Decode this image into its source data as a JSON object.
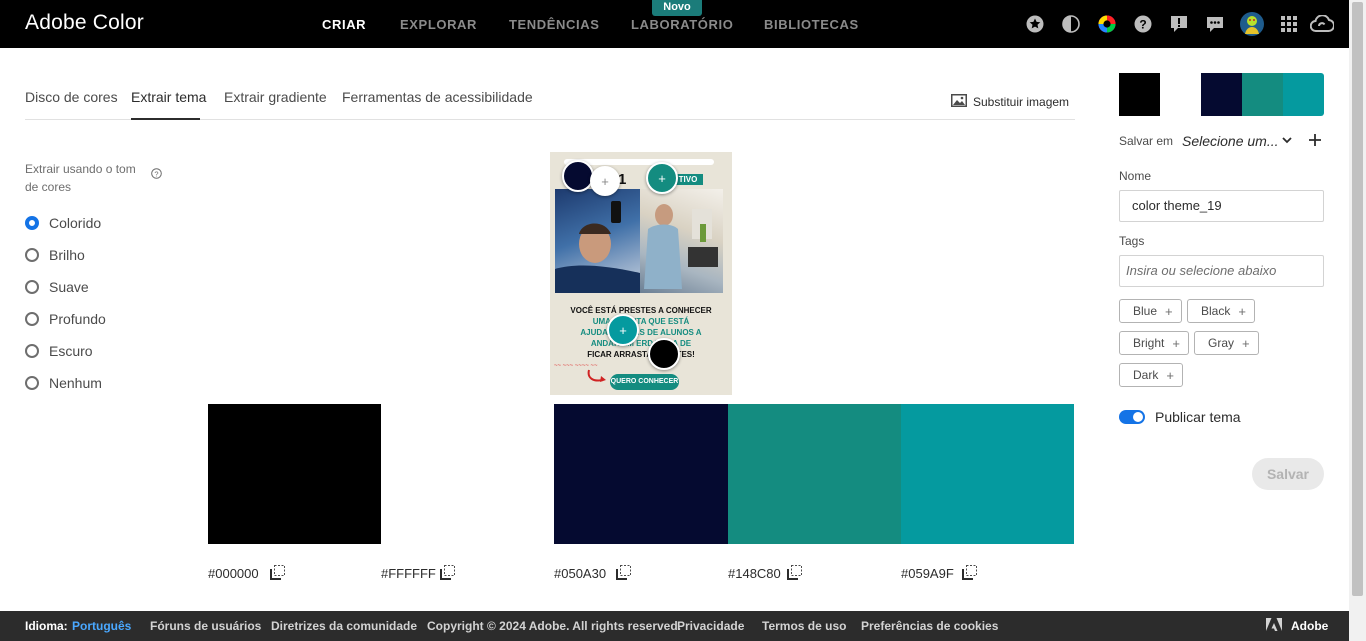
{
  "app_title": "Adobe Color",
  "nav": {
    "items": [
      {
        "label": "CRIAR",
        "active": true
      },
      {
        "label": "EXPLORAR",
        "active": false
      },
      {
        "label": "TENDÊNCIAS",
        "active": false
      },
      {
        "label": "LABORATÓRIO",
        "active": false
      },
      {
        "label": "BIBLIOTECAS",
        "active": false
      }
    ],
    "badge": "Novo"
  },
  "tabs": [
    "Disco de cores",
    "Extrair tema",
    "Extrair gradiente",
    "Ferramentas de acessibilidade"
  ],
  "replace_image": "Substituir imagem",
  "extract": {
    "label": "Extrair usando o tom de cores",
    "options": [
      "Colorido",
      "Brilho",
      "Suave",
      "Profundo",
      "Escuro",
      "Nenhum"
    ],
    "selected": "Colorido"
  },
  "preview": {
    "num": "1",
    "badge": "TIVO",
    "line1": "VOCÊ ESTÁ PRESTES A CONHECER",
    "line2": "UMA FE     ENTA QUE ESTÁ",
    "line3": "AJUDANDO      NAS DE ALUNOS A",
    "line4": "ANDAR EM     ERDA     EGA DE",
    "line5": "FICAR ARRASTANE        ENTES!",
    "cta": "QUERO CONHECER"
  },
  "swatches": [
    {
      "hex": "#000000",
      "color": "#000000"
    },
    {
      "hex": "#FFFFFF",
      "color": "#FFFFFF"
    },
    {
      "hex": "#050A30",
      "color": "#050A30"
    },
    {
      "hex": "#148C80",
      "color": "#148C80"
    },
    {
      "hex": "#059A9F",
      "color": "#059A9F"
    }
  ],
  "side": {
    "save_in_label": "Salvar em",
    "save_in_value": "Selecione um...",
    "name_label": "Nome",
    "name_value": "color theme_19",
    "tags_label": "Tags",
    "tags_placeholder": "Insira ou selecione abaixo",
    "tags": [
      "Blue",
      "Black",
      "Bright",
      "Gray",
      "Dark"
    ],
    "publish_label": "Publicar tema",
    "publish_on": true,
    "save_button": "Salvar"
  },
  "footer": {
    "lang_label": "Idioma:",
    "lang_value": "Português",
    "links": [
      "Fóruns de usuários",
      "Diretrizes da comunidade",
      "Copyright © 2024 Adobe. All rights reserved.",
      "Privacidade",
      "Termos de uso",
      "Preferências de cookies"
    ],
    "brand": "Adobe"
  },
  "icons": [
    "star-icon",
    "contrast-icon",
    "color-wheel-icon",
    "help-icon",
    "feedback-icon",
    "chat-icon",
    "user-avatar",
    "apps-grid-icon",
    "creative-cloud-icon",
    "image-icon",
    "info-icon",
    "copy-icon",
    "chevron-down-icon",
    "plus-icon",
    "adobe-logo-icon"
  ]
}
